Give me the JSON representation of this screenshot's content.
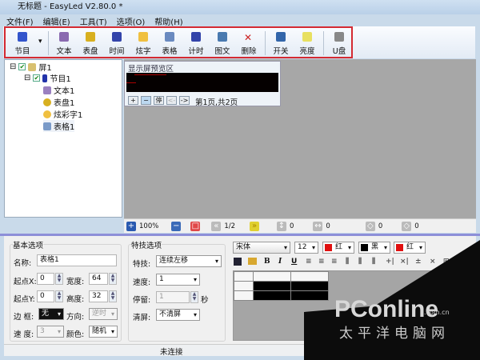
{
  "window": {
    "title": "无标题 - EasyLed V2.80.0 *"
  },
  "menu": [
    "文件(F)",
    "编辑(E)",
    "工具(T)",
    "选项(O)",
    "帮助(H)"
  ],
  "toolbar": [
    {
      "label": "节目",
      "icon": "program-icon",
      "color": "#3355cc"
    },
    {
      "label": "文本",
      "icon": "text-icon",
      "color": "#8a6ab0"
    },
    {
      "label": "表盘",
      "icon": "clock-icon",
      "color": "#d8b020"
    },
    {
      "label": "时间",
      "icon": "time-icon",
      "color": "#3344aa"
    },
    {
      "label": "炫字",
      "icon": "smiley-icon",
      "color": "#f0c040"
    },
    {
      "label": "表格",
      "icon": "table-icon",
      "color": "#6a8ac0"
    },
    {
      "label": "计时",
      "icon": "timer-icon",
      "color": "#3344aa"
    },
    {
      "label": "图文",
      "icon": "image-text-icon",
      "color": "#4a7ab0"
    },
    {
      "label": "删除",
      "icon": "delete-icon",
      "color": "#cc2222"
    },
    {
      "label": "开关",
      "icon": "power-icon",
      "color": "#3366aa"
    },
    {
      "label": "亮度",
      "icon": "brightness-icon",
      "color": "#e8e060"
    },
    {
      "label": "U盘",
      "icon": "usb-icon",
      "color": "#888888"
    }
  ],
  "tree": {
    "screen": "屏1",
    "program": "节目1",
    "items": [
      "文本1",
      "表盘1",
      "炫彩字1",
      "表格1"
    ]
  },
  "preview": {
    "title": "显示屏预览区",
    "buttons": [
      "+",
      "−",
      "停",
      "<-",
      "->"
    ],
    "page_info": "第1页,共2页"
  },
  "bottombar": {
    "zoom": "100%",
    "page": "1/2",
    "v1": "0",
    "v2": "0",
    "v3": "0",
    "v4": "0"
  },
  "basic": {
    "title": "基本选项",
    "name_label": "名称:",
    "name_value": "表格1",
    "x_label": "起点X:",
    "x_value": "0",
    "w_label": "宽度:",
    "w_value": "64",
    "y_label": "起点Y:",
    "y_value": "0",
    "h_label": "高度:",
    "h_value": "32",
    "border_label": "边 框:",
    "border_value": "无",
    "dir_label": "方向:",
    "dir_value": "逆时",
    "speed_label": "速 度:",
    "speed_value": "3",
    "color_label": "颜色:",
    "color_value": "随机"
  },
  "effects": {
    "title": "特技选项",
    "effect_label": "特技:",
    "effect_value": "连续左移",
    "speed_label": "速度:",
    "speed_value": "1",
    "stay_label": "停留:",
    "stay_value": "1",
    "stay_unit": "秒",
    "clear_label": "清屏:",
    "clear_value": "不清屏"
  },
  "format": {
    "font": "宋体",
    "size": "12",
    "color1": "红",
    "color2": "黑",
    "color3": "红",
    "buttons": [
      "B",
      "I",
      "U"
    ]
  },
  "status": {
    "text": "未连接"
  },
  "watermark": {
    "brand": "PConline",
    "domain": ".com.cn",
    "cn": "太平洋电脑网"
  }
}
